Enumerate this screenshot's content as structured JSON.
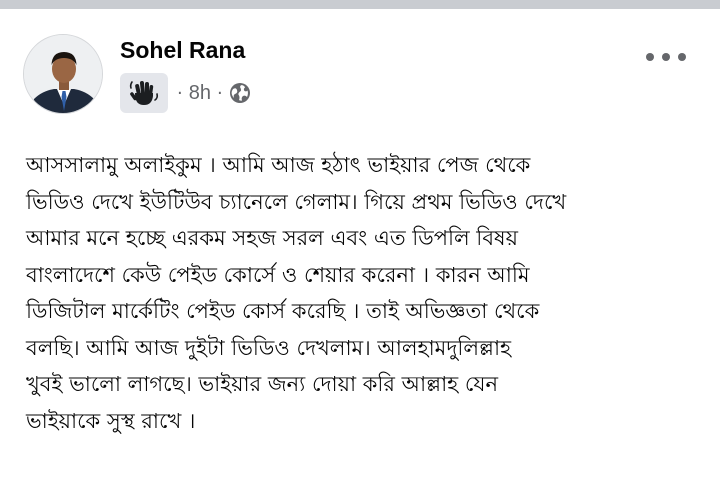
{
  "post": {
    "author": "Sohel Rana",
    "time": "8h",
    "separator": "·",
    "badge_icon": "waving-hand-icon",
    "privacy_icon": "globe-icon",
    "more_icon": "more-horizontal-icon",
    "body_lines": [
      "আসসালামু অলাইকুম । আমি আজ হঠাৎ ভাইয়ার পেজ থেকে",
      "ভিডিও দেখে ইউটিউব চ্যানেলে গেলাম। গিয়ে প্রথম ভিডিও দেখে",
      "আমার মনে হচ্ছে এরকম সহজ সরল এবং এত ডিপলি বিষয়",
      "বাংলাদেশে কেউ পেইড কোর্সে ও শেয়ার করেনা । কারন আমি",
      "ডিজিটাল মার্কেটিং পেইড কোর্স করেছি । তাই অভিজ্ঞতা থেকে",
      "বলছি। আমি আজ দুইটা ভিডিও দেখলাম। আলহামদুলিল্লাহ",
      "খুবই ভালো লাগছে। ভাইয়ার জন্য দোয়া করি আল্লাহ যেন",
      "ভাইয়াকে সুস্থ রাখে ।"
    ]
  },
  "colors": {
    "text": "#050505",
    "secondary": "#65676b",
    "badge_bg": "#e4e6eb",
    "divider": "#c9ccd1"
  }
}
